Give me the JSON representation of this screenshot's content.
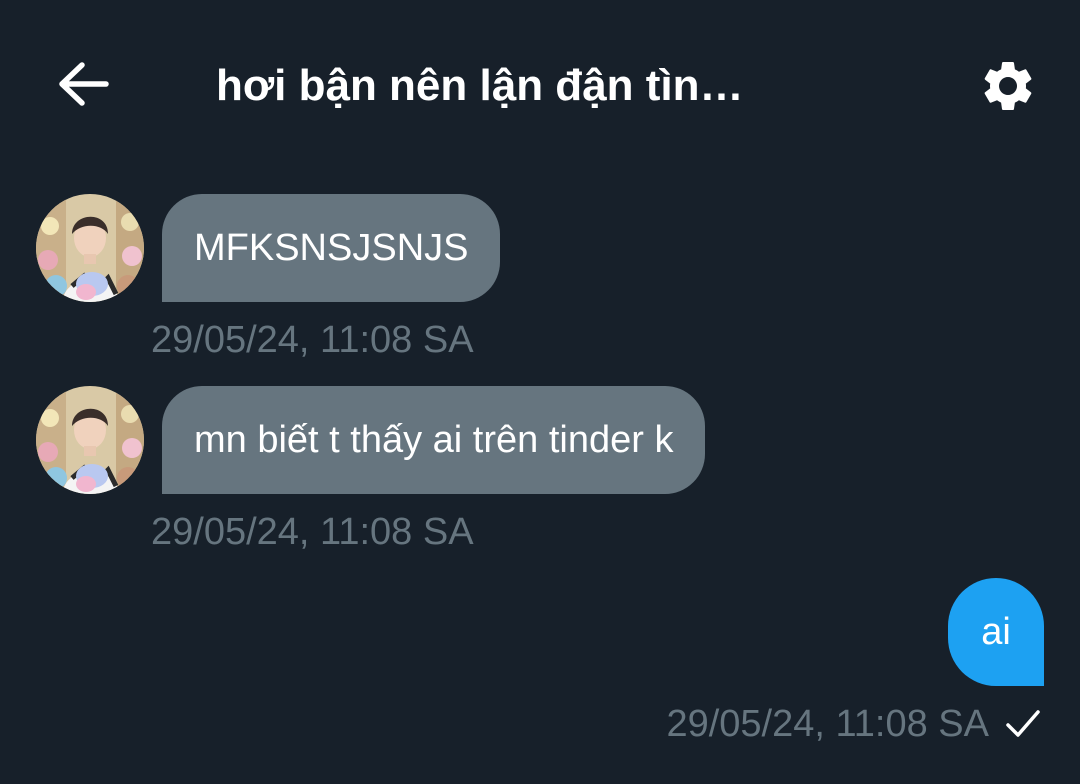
{
  "header": {
    "title": "hơi bận nên lận đận tìn…",
    "back_icon": "arrow-left-icon",
    "settings_icon": "gear-icon"
  },
  "messages": [
    {
      "direction": "incoming",
      "text": "MFKSNSJSNJS",
      "timestamp": "29/05/24, 11:08 SA"
    },
    {
      "direction": "incoming",
      "text": "mn biết t thấy ai trên tinder k",
      "timestamp": "29/05/24, 11:08 SA"
    },
    {
      "direction": "outgoing",
      "text": "ai",
      "timestamp": "29/05/24, 11:08 SA",
      "status_icon": "checkmark-icon"
    }
  ],
  "colors": {
    "background": "#17202a",
    "incoming_bubble": "#66757f",
    "outgoing_bubble": "#1da1f2",
    "timestamp": "#66757f"
  }
}
